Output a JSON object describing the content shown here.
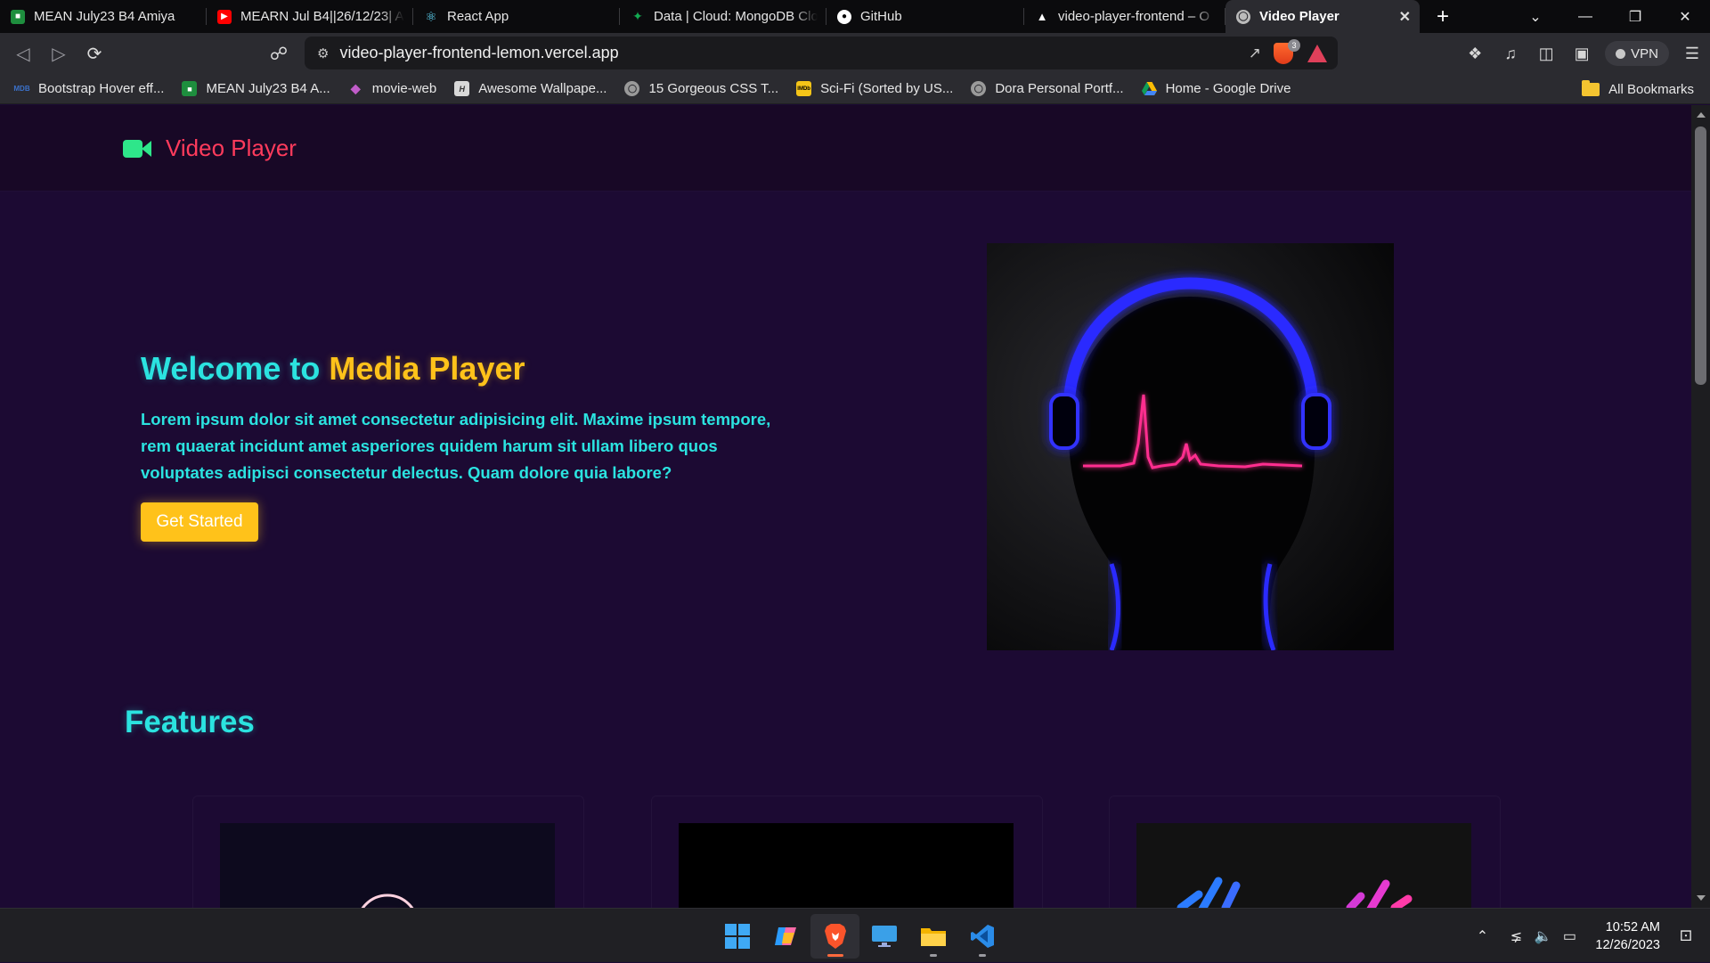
{
  "browser": {
    "tabs": [
      {
        "title": "MEAN July23 B4 Amiya",
        "icon": "classroom-icon",
        "color": "#1e8e3e",
        "active": false
      },
      {
        "title": "MEARN Jul B4||26/12/23| A",
        "icon": "youtube-icon",
        "color": "#ff0000",
        "active": false
      },
      {
        "title": "React App",
        "icon": "react-icon",
        "color": "#61dafb",
        "active": false
      },
      {
        "title": "Data | Cloud: MongoDB Clo",
        "icon": "mongodb-icon",
        "color": "#13aa52",
        "active": false
      },
      {
        "title": "GitHub",
        "icon": "github-icon",
        "color": "#ffffff",
        "active": false
      },
      {
        "title": "video-player-frontend – O",
        "icon": "vercel-icon",
        "color": "#ffffff",
        "active": false
      },
      {
        "title": "Video Player",
        "icon": "globe-icon",
        "color": "#bbbbbb",
        "active": true
      }
    ],
    "url": "video-player-frontend-lemon.vercel.app",
    "shield_count": "3",
    "vpn_label": "VPN",
    "bookmarks": [
      {
        "title": "Bootstrap Hover eff...",
        "icon": "mdb-icon",
        "badge": "MDB",
        "color": "#3b71ca"
      },
      {
        "title": "MEAN July23 B4 A...",
        "icon": "classroom-icon",
        "badge": "",
        "color": "#1e8e3e"
      },
      {
        "title": "movie-web",
        "icon": "diamond-icon",
        "badge": "",
        "color": "#c05cc9"
      },
      {
        "title": "Awesome Wallpape...",
        "icon": "wallpaper-icon",
        "badge": "",
        "color": "#9a9a9a"
      },
      {
        "title": "15 Gorgeous CSS T...",
        "icon": "globe-icon",
        "badge": "",
        "color": "#9a9a9a"
      },
      {
        "title": "Sci-Fi (Sorted by US...",
        "icon": "imdb-icon",
        "badge": "IMDb",
        "color": "#f5c518"
      },
      {
        "title": "Dora Personal Portf...",
        "icon": "globe-icon",
        "badge": "",
        "color": "#9a9a9a"
      },
      {
        "title": "Home - Google Drive",
        "icon": "google-drive-icon",
        "badge": "",
        "color": "#fbbc04"
      }
    ],
    "all_bookmarks": "All Bookmarks"
  },
  "page": {
    "brand": "Video Player",
    "hero": {
      "title_prefix": "Welcome to ",
      "title_highlight": "Media Player",
      "text": "Lorem ipsum dolor sit amet consectetur adipisicing elit. Maxime ipsum tempore, rem quaerat incidunt amet asperiores quidem harum sit ullam libero quos voluptates adipisci consectetur delectus. Quam dolore quia labore?",
      "cta": "Get Started"
    },
    "features_title": "Features"
  },
  "colors": {
    "accent_cyan": "#2be3e0",
    "accent_yellow": "#ffc21a",
    "brand_red": "#ff3b5c",
    "brand_icon": "#2ee68a",
    "page_bg": "#1c0a33"
  },
  "taskbar": {
    "apps": [
      "windows-start-icon",
      "copilot-icon",
      "brave-icon",
      "desktop-icon",
      "file-explorer-icon",
      "vscode-icon"
    ],
    "time": "10:52 AM",
    "date": "12/26/2023"
  }
}
